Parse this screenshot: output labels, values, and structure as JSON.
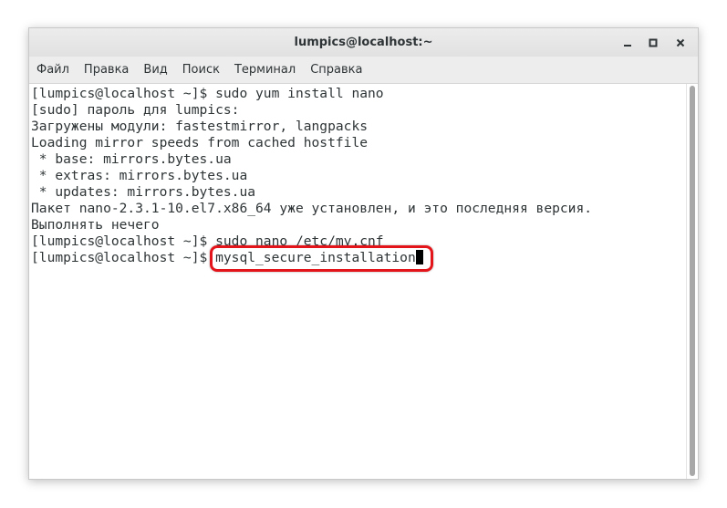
{
  "window": {
    "title": "lumpics@localhost:~",
    "controls": [
      "minimize-icon",
      "maximize-icon",
      "close-icon"
    ]
  },
  "menu": {
    "items": [
      "Файл",
      "Правка",
      "Вид",
      "Поиск",
      "Терминал",
      "Справка"
    ]
  },
  "terminal": {
    "lines": [
      "[lumpics@localhost ~]$ sudo yum install nano",
      "[sudo] пароль для lumpics:",
      "Загружены модули: fastestmirror, langpacks",
      "Loading mirror speeds from cached hostfile",
      " * base: mirrors.bytes.ua",
      " * extras: mirrors.bytes.ua",
      " * updates: mirrors.bytes.ua",
      "Пакет nano-2.3.1-10.el7.x86_64 уже установлен, и это последняя версия.",
      "Выполнять нечего",
      "[lumpics@localhost ~]$ sudo nano /etc/my.cnf"
    ],
    "current_prompt": "[lumpics@localhost ~]$ ",
    "current_command": "mysql_secure_installation"
  },
  "colors": {
    "highlight": "#e3151a",
    "text": "#2e3436",
    "titlebar": "#e6e6e6"
  }
}
